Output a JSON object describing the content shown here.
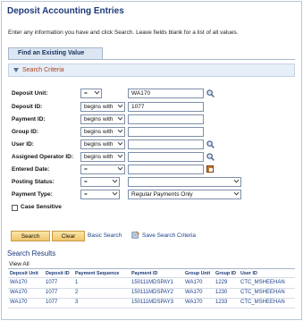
{
  "page": {
    "title": "Deposit Accounting Entries",
    "instructions": "Enter any information you have and click Search. Leave fields blank for a list of all values.",
    "tab": "Find an Existing Value",
    "section": "Search Criteria"
  },
  "criteria": {
    "deposit_unit": {
      "label": "Deposit Unit:",
      "op": "=",
      "value": "WA170"
    },
    "deposit_id": {
      "label": "Deposit ID:",
      "op": "begins with",
      "value": "1077"
    },
    "payment_id": {
      "label": "Payment ID:",
      "op": "begins with",
      "value": ""
    },
    "group_id": {
      "label": "Group ID:",
      "op": "begins with",
      "value": ""
    },
    "user_id": {
      "label": "User ID:",
      "op": "begins with",
      "value": ""
    },
    "assigned_operator_id": {
      "label": "Assigned Operator ID:",
      "op": "begins with",
      "value": ""
    },
    "entered_date": {
      "label": "Entered Date:",
      "op": "=",
      "value": ""
    },
    "posting_status": {
      "label": "Posting Status:",
      "op": "=",
      "value": ""
    },
    "payment_type": {
      "label": "Payment Type:",
      "op": "=",
      "value": "Regular Payments Only"
    },
    "case_sensitive": {
      "label": "Case Sensitive",
      "checked": false
    }
  },
  "buttons": {
    "search": "Search",
    "clear": "Clear",
    "basic_search": "Basic Search",
    "save_criteria": "Save Search Criteria"
  },
  "results": {
    "title": "Search Results",
    "view_all": "View All",
    "columns": [
      "Deposit Unit",
      "Deposit ID",
      "Payment Sequence",
      "Payment ID",
      "Group Unit",
      "Group ID",
      "User ID"
    ],
    "rows": [
      [
        "WA170",
        "1077",
        "1",
        "150111MDSPAY1",
        "WA170",
        "1229",
        "CTC_MSHEEHAN"
      ],
      [
        "WA170",
        "1077",
        "2",
        "150111MDSPAY2",
        "WA170",
        "1230",
        "CTC_MSHEEHAN"
      ],
      [
        "WA170",
        "1077",
        "3",
        "150111MDSPAY3",
        "WA170",
        "1233",
        "CTC_MSHEEHAN"
      ]
    ]
  },
  "icons": {
    "lookup": "magnifier-icon",
    "calendar": "calendar-icon",
    "save": "save-search-icon",
    "collapse": "collapse-arrow-icon"
  },
  "colors": {
    "title": "#1b3a78",
    "section_label": "#b0401c",
    "button": "#f1c56b",
    "link": "#1a3f8a"
  }
}
